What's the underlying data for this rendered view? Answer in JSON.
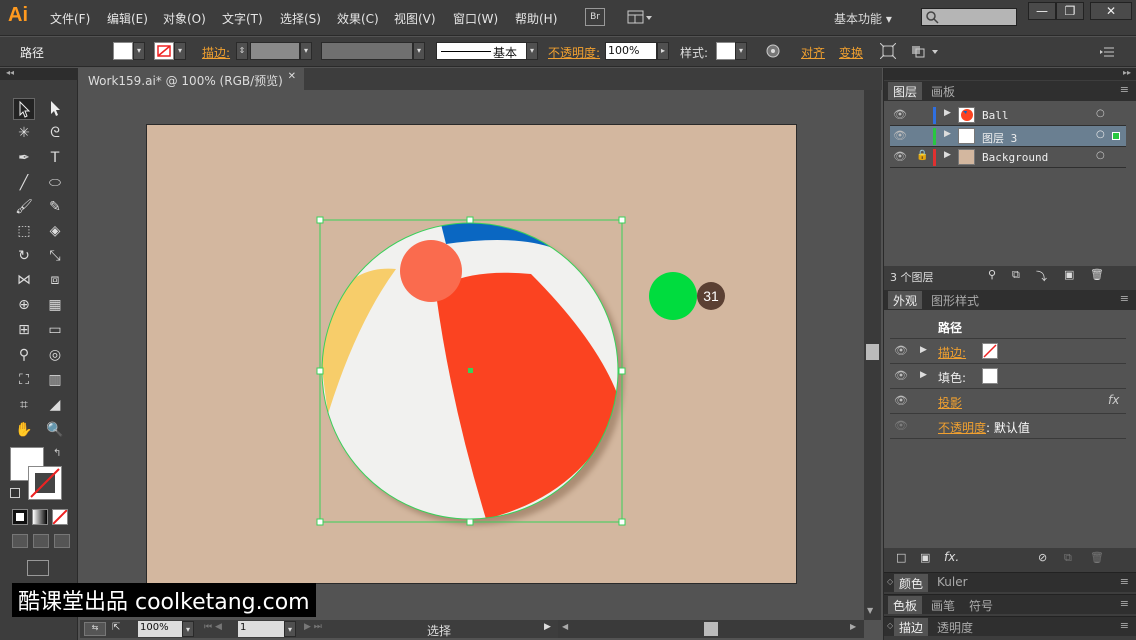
{
  "app": {
    "logo": "Ai"
  },
  "menubar": {
    "items": [
      "文件(F)",
      "编辑(E)",
      "对象(O)",
      "文字(T)",
      "选择(S)",
      "效果(C)",
      "视图(V)",
      "窗口(W)",
      "帮助(H)"
    ],
    "bridge_label": "Br",
    "workspace_label": "基本功能",
    "search_placeholder": "",
    "window_buttons": [
      "—",
      "❐",
      "✕"
    ]
  },
  "control_bar": {
    "object_type": "路径",
    "stroke_label": "描边",
    "stroke_style": "基本",
    "opacity_label": "不透明度",
    "opacity_value": "100%",
    "style_label": "样式",
    "align_label": "对齐",
    "transform_label": "变换"
  },
  "document": {
    "tab_title": "Work159.ai* @ 100% (RGB/预览)",
    "close_icon": "✕"
  },
  "canvas": {
    "badge_number": "31",
    "ball_colors": {
      "blue": "#0a67c2",
      "yellow": "#f7cd6a",
      "red": "#fb4321",
      "white": "#f1f1ef",
      "pink": "#fa6b4e"
    },
    "artboard_color": "#d3b79f",
    "cursor_dot_color": "#00dc3e"
  },
  "layers_panel": {
    "tabs": [
      "图层",
      "画板"
    ],
    "layers": [
      {
        "name": "Ball",
        "color": "#2f6fe0",
        "locked": false,
        "selected": false
      },
      {
        "name": "图层 3",
        "color": "#28c840",
        "locked": false,
        "selected": true
      },
      {
        "name": "Background",
        "color": "#e03030",
        "locked": true,
        "selected": false
      }
    ],
    "count_label": "3 个图层"
  },
  "appearance_panel": {
    "tabs": [
      "外观",
      "图形样式"
    ],
    "title": "路径",
    "stroke_label": "描边",
    "fill_label": "填色",
    "effect_label": "投影",
    "opacity_label": "不透明度",
    "opacity_value": "默认值",
    "fx_label": "fx"
  },
  "collapsed_panels": [
    {
      "tabs": [
        "颜色",
        "Kuler"
      ]
    },
    {
      "tabs": [
        "色板",
        "画笔",
        "符号"
      ]
    },
    {
      "tabs": [
        "描边",
        "透明度"
      ]
    }
  ],
  "status_bar": {
    "zoom": "100%",
    "page": "1",
    "tool": "选择"
  },
  "watermark": "酷课堂出品 coolketang.com"
}
